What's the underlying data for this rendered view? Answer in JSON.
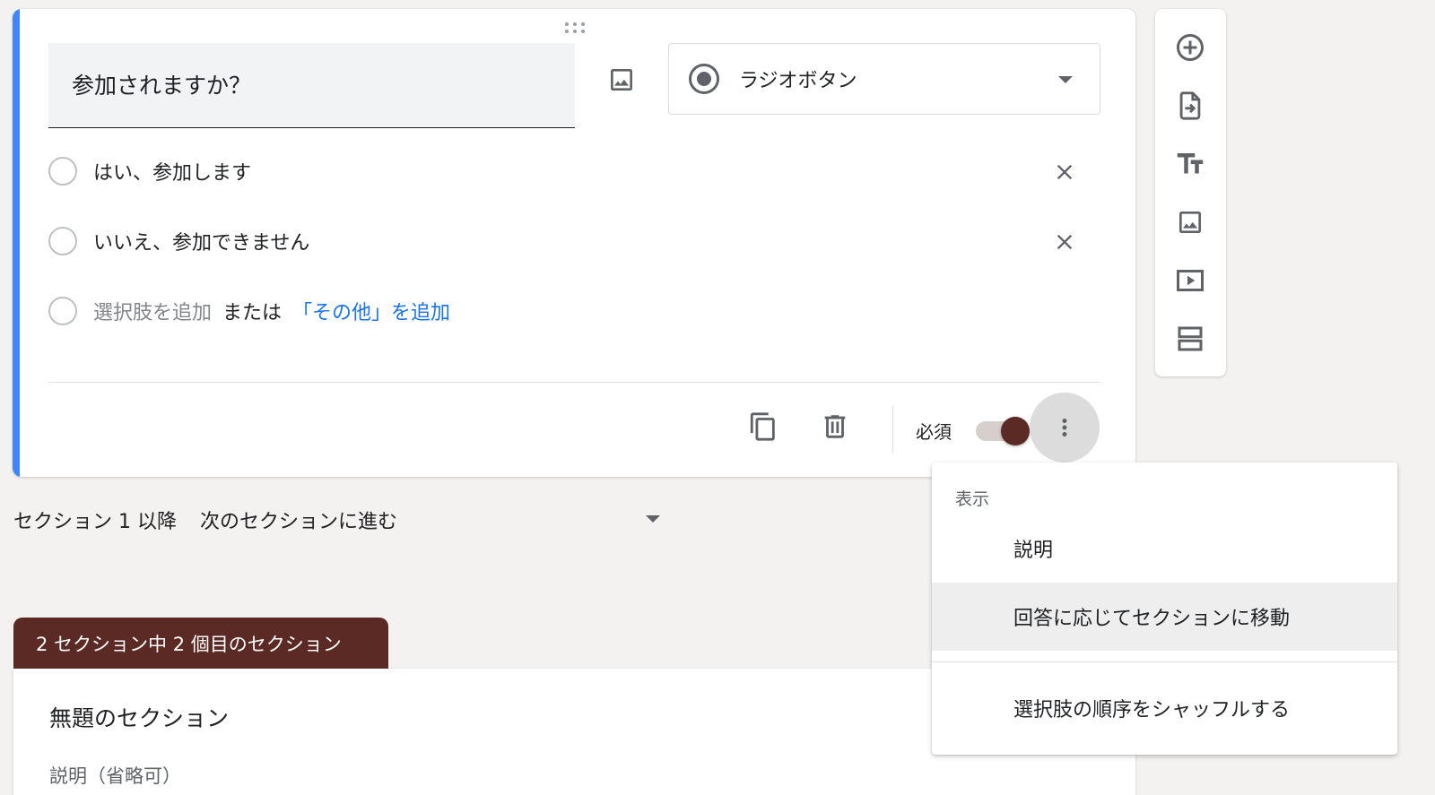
{
  "question": {
    "title": "参加されますか？",
    "type_label": "ラジオボタン",
    "options": [
      {
        "label": "はい、参加します"
      },
      {
        "label": "いいえ、参加できません"
      }
    ],
    "add_option": "選択肢を追加",
    "or_text": "または",
    "add_other": "「その他」を追加",
    "required_label": "必須",
    "required": true
  },
  "side_toolbar": {
    "icons": [
      "add-question-icon",
      "import-questions-icon",
      "add-title-icon",
      "add-image-icon",
      "add-video-icon",
      "add-section-icon"
    ]
  },
  "after_section": {
    "prefix": "セクション 1 以降",
    "value": "次のセクションに進む"
  },
  "section2": {
    "tab_label": "2 セクション中 2 個目のセクション",
    "title": "無題のセクション",
    "description_placeholder": "説明（省略可）"
  },
  "menu": {
    "header": "表示",
    "items": [
      {
        "label": "説明"
      },
      {
        "label": "回答に応じてセクションに移動",
        "highlighted": true
      },
      {
        "label": "選択肢の順序をシャッフルする"
      }
    ]
  },
  "colors": {
    "accent": "#4285f4",
    "theme": "#5c2a25",
    "link": "#1a73e8",
    "background": "#f4f2f0"
  }
}
